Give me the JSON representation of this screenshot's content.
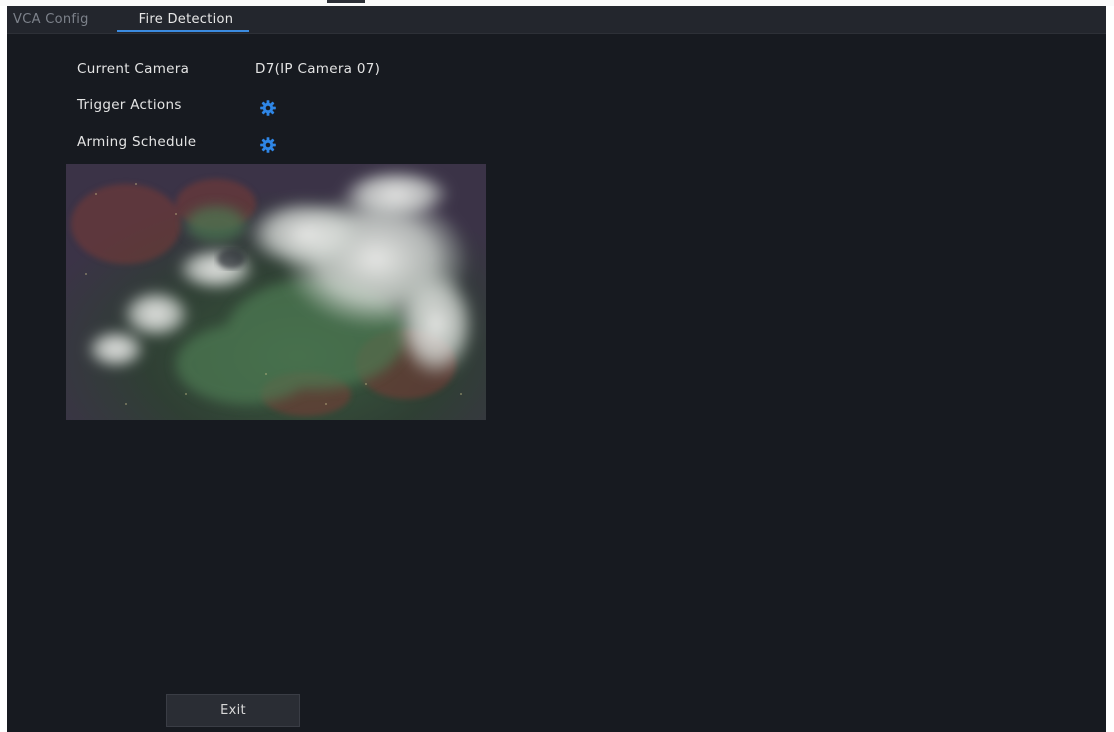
{
  "tabs": [
    {
      "label": "VCA Config"
    },
    {
      "label": "Fire Detection"
    }
  ],
  "form": {
    "current_camera_label": "Current Camera",
    "current_camera_value": "D7(IP Camera 07)",
    "trigger_actions_label": "Trigger Actions",
    "arming_schedule_label": "Arming Schedule"
  },
  "buttons": {
    "exit_label": "Exit"
  },
  "colors": {
    "accent": "#3b8be0",
    "panel_bg": "#171a20",
    "icon": "#2f86e6"
  },
  "icons": {
    "trigger_actions": "gear-icon",
    "arming_schedule": "gear-icon"
  }
}
